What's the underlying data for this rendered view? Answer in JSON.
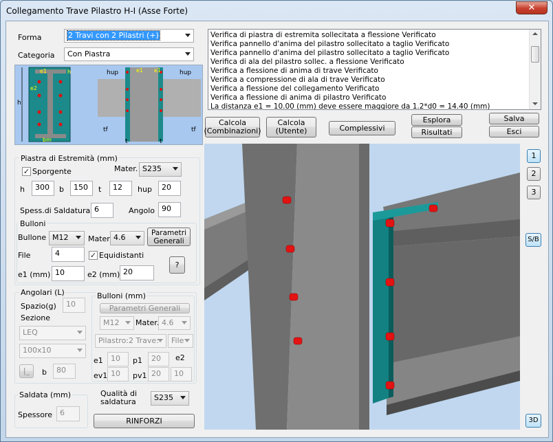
{
  "window": {
    "title": "Collegamento Trave Pilastro H-I (Asse Forte)",
    "close": "✕"
  },
  "forma": {
    "label": "Forma",
    "value": "2 Travi con 2 Pilastri (+)"
  },
  "categoria": {
    "label": "Categoria",
    "value": "Con Piastra"
  },
  "preview": {
    "left": {
      "h": "h",
      "e1": "e1",
      "e2": "e2",
      "bm": "bm",
      "h_small": "h"
    },
    "right": {
      "hup_l": "hup",
      "hup_r": "hup",
      "e1_l": "e1",
      "e1_r": "e1",
      "tf_l": "tf",
      "tf_r": "tf",
      "t_l": "t",
      "t_r": "t"
    }
  },
  "messages": [
    "Verifica di piastra di estremita sollecitata a flessione Verificato",
    "Verifica pannello d'anima del pilastro sollecitato a taglio Verificato",
    "Verifica pannello d'anima del pilastro sollecitato a taglio Verificato",
    "Verifica di ala del pilastro sollec. a flessione Verificato",
    "Verifica a flessione di anima di trave     Verificato",
    "Verifica a compressione di ala di trave Verificato",
    "Verifica a flessione del collegamento Verificato",
    "Verifica a flessione di anima di pilastro  Verificato",
    "La distanza e1 = 10.00 (mm) deve essere maggiore da      1.2*d0 = 14.40 (mm)"
  ],
  "buttons": {
    "calcola_comb": [
      "Calcola",
      "(Combinazioni)"
    ],
    "calcola_utente": [
      "Calcola",
      "(Utente)"
    ],
    "complessivi": "Complessivi",
    "esplora": "Esplora",
    "risultati": "Risultati",
    "salva": "Salva",
    "esci": "Esci"
  },
  "piastra": {
    "title": "Piastra di Estremità (mm)",
    "sporgente": "Sporgente",
    "mater_label": "Mater.",
    "mater": "S235",
    "h_label": "h",
    "h": "300",
    "b_label": "b",
    "b": "150",
    "t_label": "t",
    "t": "12",
    "hup_label": "hup",
    "hup": "20",
    "spess_label": "Spess.di Saldatura",
    "spess": "6",
    "angolo_label": "Angolo",
    "angolo": "90"
  },
  "bulloni": {
    "title": "Bulloni",
    "bullone_label": "Bullone",
    "bullone": "M12",
    "mater_label": "Mater",
    "mater": "4.6",
    "parametri": [
      "Parametri",
      "Generali"
    ],
    "file_label": "File",
    "file": "4",
    "equidistanti": "Equidistanti",
    "help": "?",
    "e1_label": "e1 (mm)",
    "e1": "10",
    "e2_label": "e2 (mm)",
    "e2": "20"
  },
  "angolari": {
    "title": "Angolari (L)",
    "spazio_label": "Spazio(g)",
    "spazio": "10",
    "sezione_label": "Sezione",
    "sezione": "LEQ",
    "size": "100x10",
    "shape": "|_",
    "b_label": "b",
    "b": "80"
  },
  "bulloni2": {
    "title": "Bulloni (mm)",
    "parametri": "Parametri Generali",
    "bullone": "M12",
    "mater_label": "Mater.",
    "mater": "4.6",
    "pilastro": "Pilastro:2 Trave:",
    "file": "File",
    "e1_label": "e1",
    "e1": "10",
    "p1_label": "p1",
    "p1": "20",
    "e2_label": "e2",
    "ev1_label": "ev1",
    "ev1": "10",
    "pv1_label": "pv1",
    "pv1": "20",
    "e2": "10"
  },
  "saldata": {
    "title": "Saldata (mm)",
    "spessore_label": "Spessore",
    "spessore": "6",
    "qualita_label": [
      "Qualità di",
      "saldatura"
    ],
    "qualita": "S235",
    "rinforzi": "RINFORZI"
  },
  "side": {
    "b1": "1",
    "b2": "2",
    "b3": "3",
    "sb": "S/B",
    "d3": "3D"
  },
  "colors": {
    "steel": "#6f6f6f",
    "plate": "#1c8a8a",
    "bolt": "#e01010",
    "preview_bg": "#a8c8f0"
  }
}
